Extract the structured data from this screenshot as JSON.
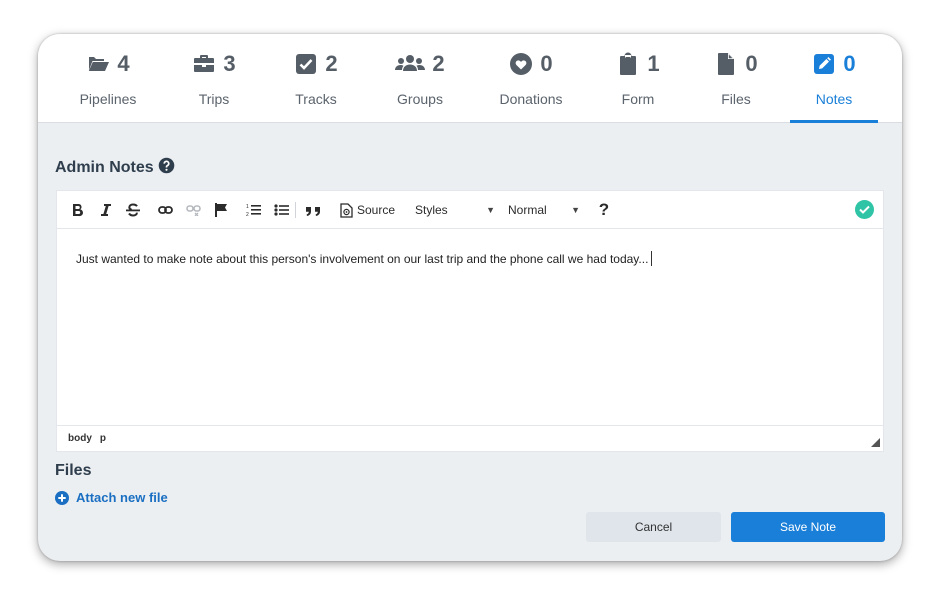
{
  "tabs": [
    {
      "count": "4",
      "label": "Pipelines",
      "icon": "folder-open-icon"
    },
    {
      "count": "3",
      "label": "Trips",
      "icon": "briefcase-icon"
    },
    {
      "count": "2",
      "label": "Tracks",
      "icon": "check-square-icon"
    },
    {
      "count": "2",
      "label": "Groups",
      "icon": "users-icon"
    },
    {
      "count": "0",
      "label": "Donations",
      "icon": "heart-circle-icon"
    },
    {
      "count": "1",
      "label": "Form",
      "icon": "clipboard-icon"
    },
    {
      "count": "0",
      "label": "Files",
      "icon": "file-icon"
    },
    {
      "count": "0",
      "label": "Notes",
      "icon": "edit-square-icon",
      "active": true
    }
  ],
  "admin_notes": {
    "title": "Admin Notes",
    "help_icon": "question-circle-icon"
  },
  "editor": {
    "toolbar": {
      "source_label": "Source",
      "styles_label": "Styles",
      "format_label": "Normal",
      "help_label": "?"
    },
    "content": "Just wanted to make note about this person's involvement on our last trip and the phone call we had today...",
    "path": [
      "body",
      "p"
    ]
  },
  "files": {
    "title": "Files",
    "attach_label": "Attach new file"
  },
  "actions": {
    "cancel_label": "Cancel",
    "save_label": "Save Note"
  },
  "colors": {
    "accent": "#1a7fd8",
    "success": "#2ec4a5",
    "panel_bg": "#eceff2",
    "tab_icon": "#555d66"
  }
}
